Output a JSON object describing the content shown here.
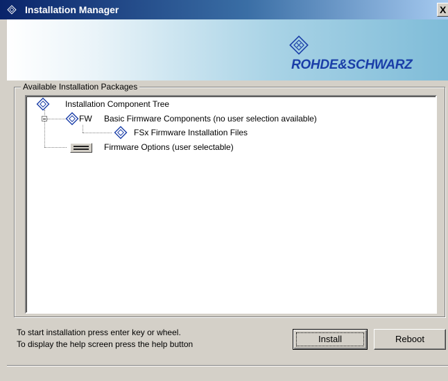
{
  "window": {
    "title": "Installation Manager",
    "close_label": "X",
    "title_icon": "rs-logo-icon"
  },
  "brand": {
    "name": "ROHDE&SCHWARZ",
    "logo_icon": "rs-logo-icon",
    "color": "#1a3ea8"
  },
  "packages": {
    "group_label": "Available Installation Packages",
    "tree": {
      "root": {
        "label": "Installation Component Tree",
        "icon": "rs-logo-icon"
      },
      "nodes": [
        {
          "prefix": "FW",
          "label": "Basic Firmware Components (no user selection available)",
          "icon": "rs-logo-icon",
          "expanded": true
        },
        {
          "label": "FSx Firmware Installation Files",
          "icon": "rs-logo-icon"
        },
        {
          "label": "Firmware Options (user selectable)",
          "icon": "options-icon"
        }
      ]
    }
  },
  "footer": {
    "line1": "To start installation press enter key or wheel.",
    "line2": "To display the help screen press the help button"
  },
  "buttons": {
    "install": "Install",
    "reboot": "Reboot"
  },
  "colors": {
    "titlebar_start": "#0a246a",
    "face": "#d4d0c8",
    "logo_blue": "#1a3ea8"
  }
}
